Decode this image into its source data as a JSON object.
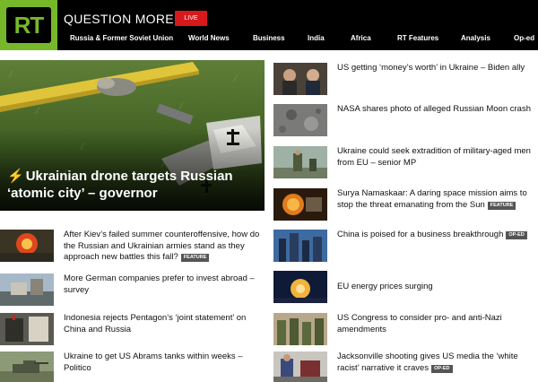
{
  "header": {
    "logo": "RT",
    "tagline": "QUESTION MORE",
    "live_label": "LIVE",
    "nav": [
      "Russia & Former Soviet Union",
      "World News",
      "Business",
      "India",
      "Africa",
      "RT Features",
      "Analysis",
      "Op-ed"
    ]
  },
  "hero": {
    "title": "Ukrainian drone targets Russian ‘atomic city’ – governor",
    "icon": "lightning-icon"
  },
  "left_articles": [
    {
      "title": "After Kiev’s failed summer counteroffensive, how do the Russian and Ukrainian armies stand as they approach new battles this fall?",
      "badge": "FEATURE"
    },
    {
      "title": "More German companies prefer to invest abroad – survey",
      "badge": ""
    },
    {
      "title": "Indonesia rejects Pentagon’s ‘joint statement’ on China and Russia",
      "badge": ""
    },
    {
      "title": "Ukraine to get US Abrams tanks within weeks – Politico",
      "badge": ""
    }
  ],
  "right_articles": [
    {
      "title": "US getting ‘money’s worth’ in Ukraine – Biden ally",
      "badge": ""
    },
    {
      "title": "NASA shares photo of alleged Russian Moon crash",
      "badge": ""
    },
    {
      "title": "Ukraine could seek extradition of military-aged men from EU – senior MP",
      "badge": ""
    },
    {
      "title": "Surya Namaskaar: A daring space mission aims to stop the threat emanating from the Sun",
      "badge": "FEATURE"
    },
    {
      "title": "China is poised for a business breakthrough",
      "badge": "OP-ED"
    },
    {
      "title": "EU energy prices surging",
      "badge": ""
    },
    {
      "title": "US Congress to consider pro- and anti-Nazi amendments",
      "badge": ""
    },
    {
      "title": "Jacksonville shooting gives US media the ‘white racist’ narrative it craves",
      "badge": "OP-ED"
    }
  ],
  "colors": {
    "brand_green": "#76b82a",
    "live_red": "#d8191c",
    "header_bg": "#000000",
    "badge_bg": "#555555"
  }
}
